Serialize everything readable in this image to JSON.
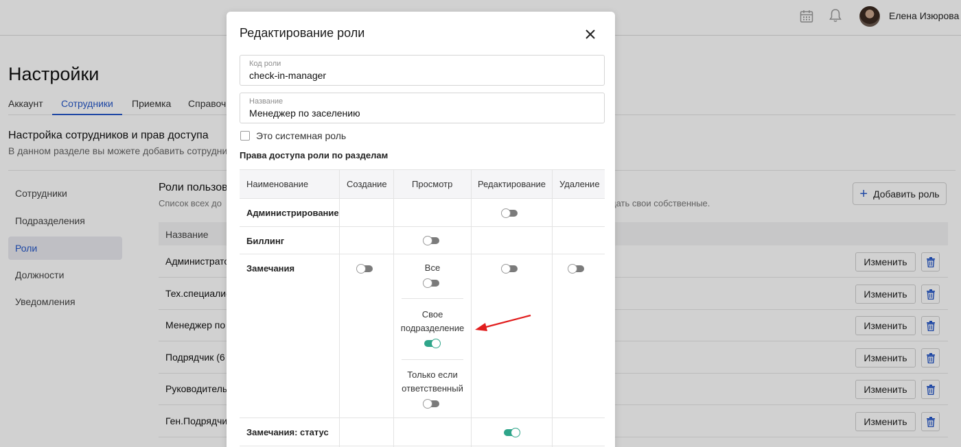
{
  "header": {
    "user_name": "Елена Изюрова"
  },
  "page": {
    "title": "Настройки",
    "tabs": [
      {
        "label": "Аккаунт"
      },
      {
        "label": "Сотрудники",
        "active": true
      },
      {
        "label": "Приемка"
      },
      {
        "label": "Справочн"
      }
    ],
    "section_title": "Настройка сотрудников и прав доступа",
    "section_desc": "В данном разделе вы можете добавить сотрудник"
  },
  "sidebar": {
    "items": [
      {
        "label": "Сотрудники"
      },
      {
        "label": "Подразделения"
      },
      {
        "label": "Роли",
        "active": true
      },
      {
        "label": "Должности"
      },
      {
        "label": "Уведомления"
      }
    ]
  },
  "roles": {
    "title": "Роли пользов",
    "desc_left": "Список всех до",
    "desc_right": "дать свои собственные.",
    "add_button": "Добавить роль",
    "column_name": "Название",
    "edit_label": "Изменить",
    "rows": [
      {
        "name": "Администрато"
      },
      {
        "name": "Тех.специалис"
      },
      {
        "name": "Менеджер по"
      },
      {
        "name": "Подрядчик (6"
      },
      {
        "name": "Руководитель"
      },
      {
        "name": "Ген.Подрядчи"
      }
    ]
  },
  "modal": {
    "title": "Редактирование роли",
    "code_field": {
      "label": "Код роли",
      "value": "check-in-manager"
    },
    "name_field": {
      "label": "Название",
      "value": "Менеджер по заселению"
    },
    "system_role_label": "Это системная роль",
    "system_role_checked": false,
    "permissions_title": "Права доступа роли по разделам",
    "columns": [
      "Наименование",
      "Создание",
      "Просмотр",
      "Редактирование",
      "Удаление"
    ],
    "rows": [
      {
        "name": "Администрирование",
        "edit": false
      },
      {
        "name": "Биллинг",
        "view": false
      },
      {
        "name": "Замечания",
        "create": false,
        "view_options": [
          {
            "label": "Все",
            "on": false
          },
          {
            "label": "Свое подразделение",
            "on": true
          },
          {
            "label": "Только если ответственный",
            "on": false
          }
        ],
        "edit": false,
        "delete": false
      },
      {
        "name": "Замечания: статус",
        "edit": true
      }
    ]
  },
  "colors": {
    "accent": "#2557c8",
    "toggle_on": "#2fa58a",
    "toggle_off": "#7b7b7b",
    "arrow": "#e11d1d"
  }
}
